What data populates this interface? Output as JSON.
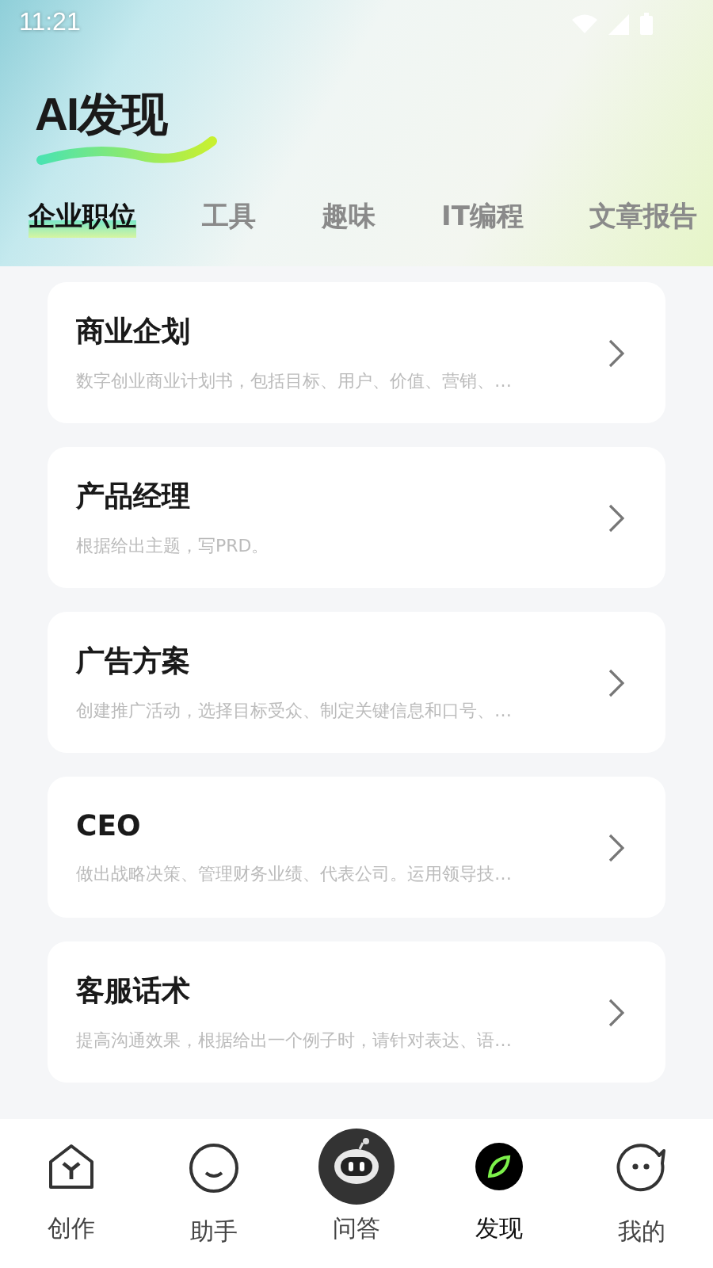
{
  "status_bar": {
    "time": "11:21"
  },
  "title": "AI发现",
  "tabs": [
    {
      "label": "企业职位",
      "selected": true
    },
    {
      "label": "工具",
      "selected": false
    },
    {
      "label": "趣味",
      "selected": false
    },
    {
      "label": "IT编程",
      "selected": false
    },
    {
      "label": "文章报告",
      "selected": false
    }
  ],
  "cards": [
    {
      "title": "商业企划",
      "description": "数字创业商业计划书，包括目标、用户、价值、营销、…"
    },
    {
      "title": "产品经理",
      "description": "根据给出主题，写PRD。"
    },
    {
      "title": "广告方案",
      "description": "创建推广活动，选择目标受众、制定关键信息和口号、…"
    },
    {
      "title": "CEO",
      "description": "做出战略决策、管理财务业绩、代表公司。运用领导技…"
    },
    {
      "title": "客服话术",
      "description": "提高沟通效果，根据给出一个例子时，请针对表达、语…"
    }
  ],
  "bottom_nav": [
    {
      "label": "创作",
      "kind": "house",
      "selected": false
    },
    {
      "label": "助手",
      "kind": "smile",
      "selected": false
    },
    {
      "label": "问答",
      "kind": "robot",
      "selected": false
    },
    {
      "label": "发现",
      "kind": "leaf",
      "selected": true
    },
    {
      "label": "我的",
      "kind": "face",
      "selected": false
    }
  ]
}
